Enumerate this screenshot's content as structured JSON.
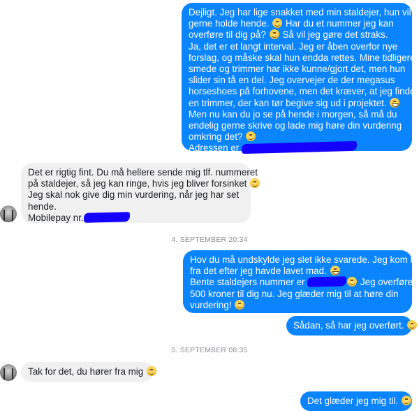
{
  "conversation": {
    "msg1": {
      "lines": [
        "Dejligt. Jeg har lige snakket med min staldejer, hun vil",
        "gerne holde hende.",
        "Har du et nummer jeg kan",
        "overføre til dig på?",
        "Så vil jeg gøre det straks.",
        "Ja, det er et langt interval. Jeg er åben overfor nye",
        "forslag, og måske skal hun endda rettes. Mine tidligere",
        "smede og trimmer har ikke kunne/gjort det, men hun",
        "slider sin tå en del. Jeg overvejer de der megasus",
        "horseshoes på forhovene, men det kræver, at jeg finder",
        "en trimmer, der kan tør begive sig ud i projektet.",
        "Men nu kan du jo se på hende i morgen, så må du",
        "endelig gerne skrive og lade mig høre din vurdering",
        "omkring det?",
        "Adressen er"
      ]
    },
    "msg2": {
      "lines": [
        "Det er rigtig fint. Du må hellere sende mig tlf. nummeret",
        "på staldejer, så jeg kan ringe, hvis jeg bliver forsinket",
        "Jeg skal nok give dig min vurdering, når jeg har set",
        "hende.",
        "Mobilepay nr."
      ]
    },
    "timestamp1": "4. SEPTEMBER 20:34",
    "msg3": {
      "lines": [
        "Hov du må undskylde jeg slet ikke svarede. Jeg kom lige",
        "fra det efter jeg havde lavet mad.",
        "Bente staldejers nummer er",
        "Jeg overfører",
        "500 kroner til dig nu. Jeg glæder mig til at høre din",
        "vurdering!"
      ]
    },
    "msg4": {
      "text": "Sådan, så har jeg overført."
    },
    "timestamp2": "5. SEPTEMBER 08:35",
    "msg5": {
      "text": "Tak for det, du hører fra mig"
    },
    "msg6": {
      "text": "Det glæder jeg mig til."
    }
  },
  "colors": {
    "outgoing_bubble": "#0a84ff",
    "incoming_bubble": "#f0f0f1",
    "redaction": "#1400ff"
  },
  "icons": [
    "smile-emoji-icon",
    "grin-emoji-icon",
    "contact-avatar"
  ]
}
